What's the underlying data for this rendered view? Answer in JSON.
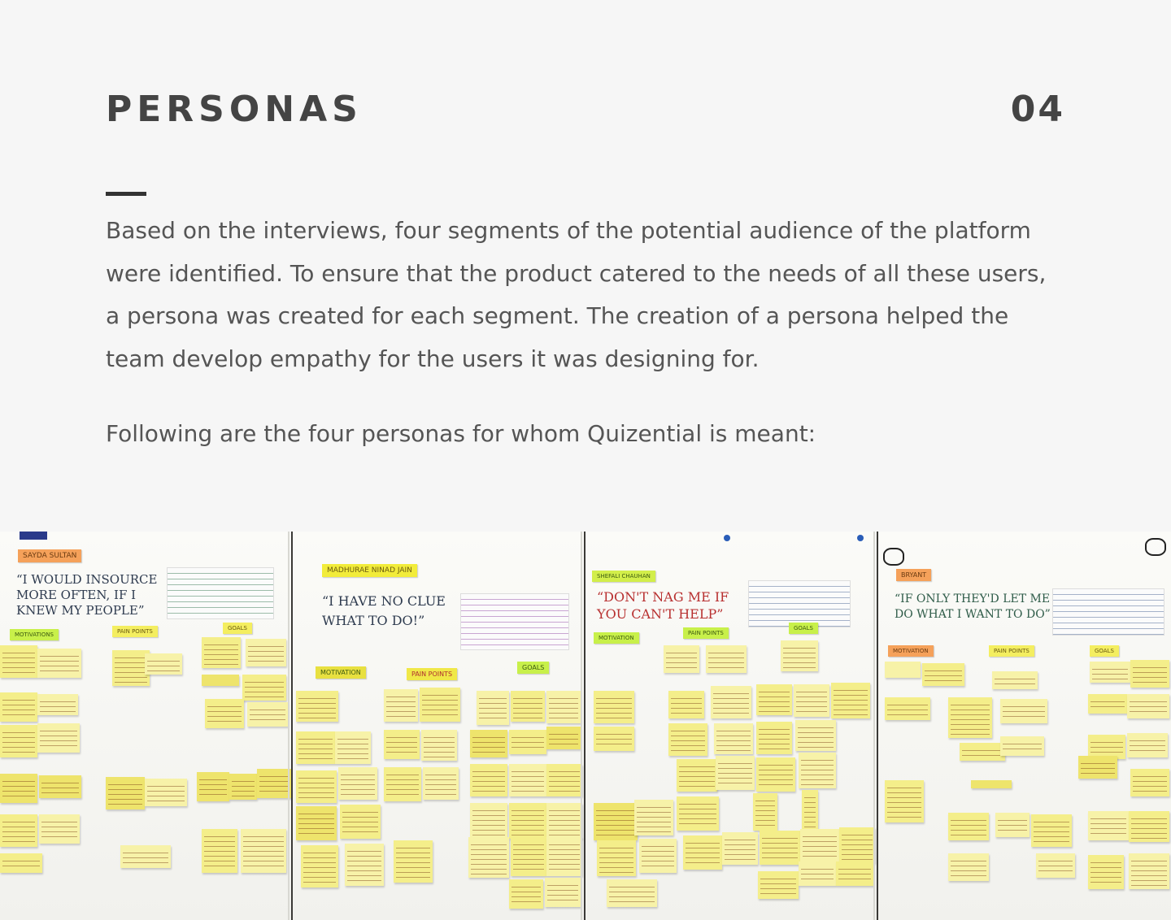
{
  "header": {
    "title": "PERSONAS",
    "section_number": "04"
  },
  "content": {
    "paragraph": "Based on the interviews, four segments of the potential audience of the platform were identified. To ensure that the product catered to the needs of all these users, a persona was created for each segment. The creation of a persona helped the team develop empathy for the users it was designing for.",
    "follow_up": "Following are the four personas for whom Quizential is meant:"
  },
  "photo": {
    "boards": [
      {
        "name": "SAYDA SULTAN",
        "quote": "“I WOULD INSOURCE MORE OFTEN, IF I KNEW MY PEOPLE”",
        "columns": [
          "MOTIVATIONS",
          "PAIN POINTS",
          "GOALS"
        ]
      },
      {
        "name": "MADHURAE NINAD JAIN",
        "quote": "“I HAVE NO CLUE WHAT TO DO!”",
        "columns": [
          "MOTIVATION",
          "PAIN POINTS",
          "GOALS"
        ]
      },
      {
        "name": "SHEFALI CHAUHAN",
        "quote": "“DON'T NAG ME IF YOU CAN'T HELP”",
        "columns": [
          "MOTIVATION",
          "PAIN POINTS",
          "GOALS"
        ]
      },
      {
        "name": "BRYANT",
        "quote": "“IF ONLY THEY'D LET ME DO WHAT I WANT TO DO”",
        "columns": [
          "MOTIVATION",
          "PAIN POINTS",
          "GOALS"
        ]
      }
    ]
  }
}
